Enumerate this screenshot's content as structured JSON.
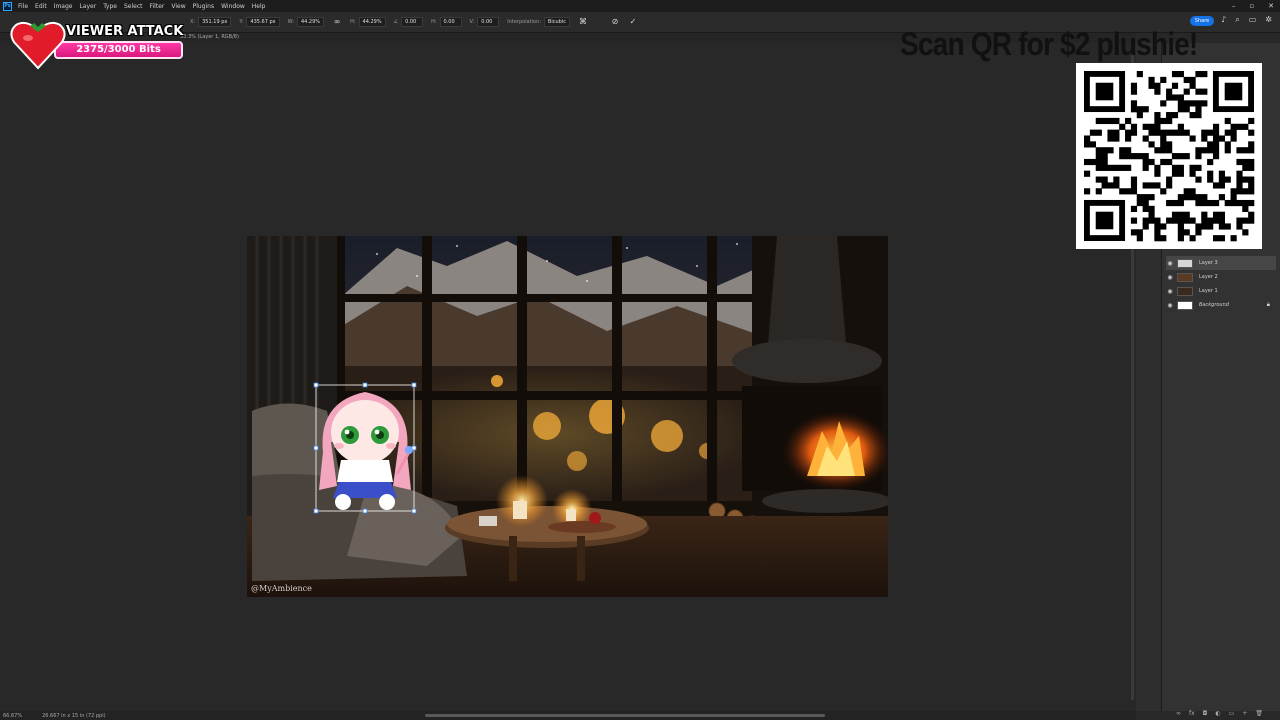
{
  "app": {
    "menu": [
      "File",
      "Edit",
      "Image",
      "Layer",
      "Type",
      "Select",
      "Filter",
      "View",
      "Plugins",
      "Window",
      "Help"
    ],
    "logo": "Ps"
  },
  "options": {
    "x_label": "X:",
    "x_value": "351.19 px",
    "y_label": "Y:",
    "y_value": "435.67 px",
    "w_label": "W:",
    "w_value": "44.29%",
    "h_label": "H:",
    "h_value": "44.29%",
    "angle_label": "∠",
    "angle_value": "0.00",
    "hskew_label": "H:",
    "hskew_value": "0.00",
    "vskew_label": "V:",
    "vskew_value": "0.00",
    "interp_label": "Interpolation:",
    "interp_value": "Bicubic",
    "share_label": "Share"
  },
  "document": {
    "tab_label": "33.3% (Layer 1, RGB/8)",
    "watermark": "@MyAmbience"
  },
  "layers": [
    {
      "name": "Layer 3",
      "selected": true,
      "locked": false
    },
    {
      "name": "Layer 2",
      "selected": false,
      "locked": false
    },
    {
      "name": "Layer 1",
      "selected": false,
      "locked": false
    },
    {
      "name": "Background",
      "selected": false,
      "locked": true
    }
  ],
  "status": {
    "zoom": "66.67%",
    "doc_size": "26.667 in x 15 in (72 ppi)"
  },
  "overlay": {
    "viewer_attack_title": "VIEWER ATTACK",
    "bits_progress": "2375/3000 Bits",
    "bits_fraction": 0.79,
    "qr_caption": "Scan QR for $2 plushie!"
  },
  "colors": {
    "accent": "#1473e6",
    "bits_bar": "#e8238f"
  }
}
